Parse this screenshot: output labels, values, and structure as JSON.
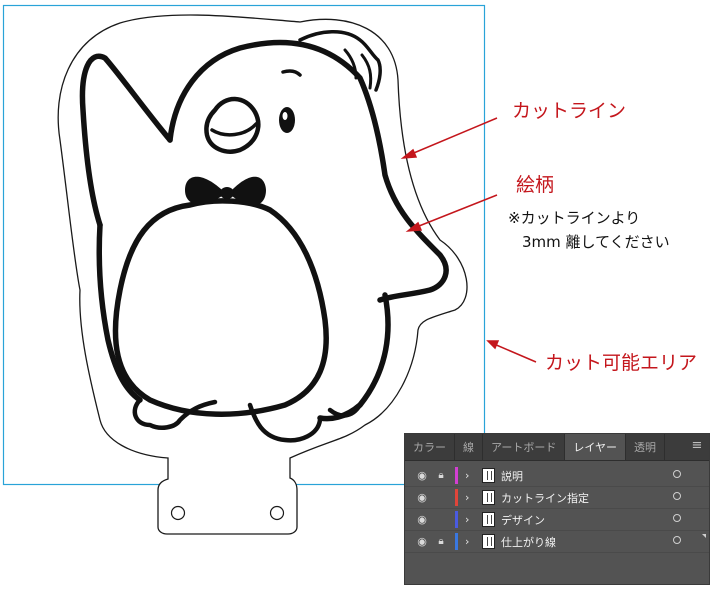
{
  "annotations": {
    "cut_line": "カットライン",
    "design": "絵柄",
    "note_line1": "※カットラインより",
    "note_line2": "3mm 離してください",
    "cuttable_area": "カット可能エリア"
  },
  "colors": {
    "annotation_red": "#c4161c",
    "artboard_blue": "#29a3d8",
    "panel_bg": "#535353"
  },
  "panel": {
    "tabs": [
      {
        "label": "カラー",
        "active": false
      },
      {
        "label": "線",
        "active": false
      },
      {
        "label": "アートボード",
        "active": false
      },
      {
        "label": "レイヤー",
        "active": true
      },
      {
        "label": "透明",
        "active": false
      }
    ],
    "menu_icon": "hamburger-menu-icon",
    "layers": [
      {
        "name": "説明",
        "color": "#d23fd2",
        "locked": true,
        "visible": true
      },
      {
        "name": "カットライン指定",
        "color": "#e0453a",
        "locked": false,
        "visible": true
      },
      {
        "name": "デザイン",
        "color": "#4a5be0",
        "locked": false,
        "visible": true
      },
      {
        "name": "仕上がり線",
        "color": "#3a78e0",
        "locked": true,
        "visible": true
      }
    ]
  }
}
